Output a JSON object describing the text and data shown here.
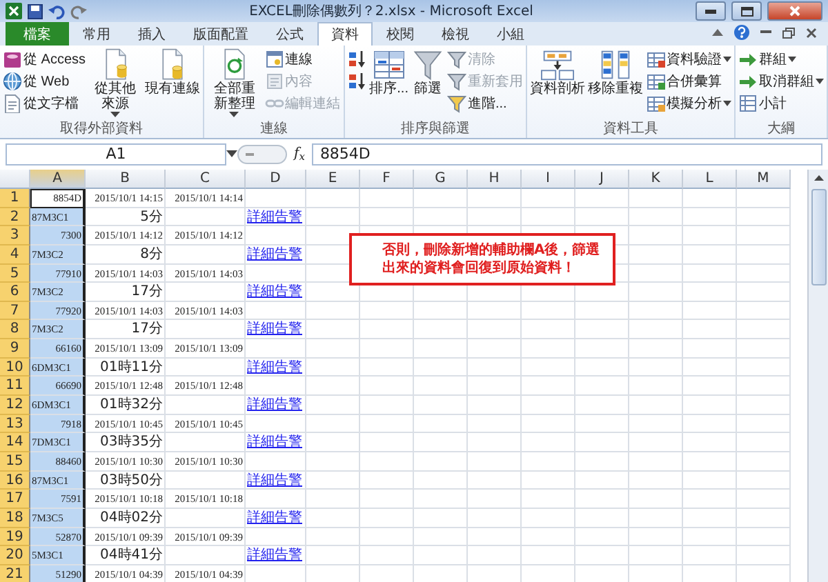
{
  "window": {
    "title": "EXCEL刪除偶數列？2.xlsx - Microsoft Excel"
  },
  "ribbon_tabs": [
    {
      "label": "檔案",
      "kind": "file",
      "selected": false
    },
    {
      "label": "常用",
      "kind": "tab",
      "selected": false
    },
    {
      "label": "插入",
      "kind": "tab",
      "selected": false
    },
    {
      "label": "版面配置",
      "kind": "tab",
      "selected": false
    },
    {
      "label": "公式",
      "kind": "tab",
      "selected": false
    },
    {
      "label": "資料",
      "kind": "tab",
      "selected": true
    },
    {
      "label": "校閱",
      "kind": "tab",
      "selected": false
    },
    {
      "label": "檢視",
      "kind": "tab",
      "selected": false
    },
    {
      "label": "小組",
      "kind": "tab",
      "selected": false
    }
  ],
  "ribbon_groups": [
    {
      "label": "取得外部資料",
      "columns": [
        [
          {
            "kind": "small",
            "label": "從 Access",
            "disabled": false
          },
          {
            "kind": "small",
            "label": "從 Web",
            "disabled": false
          },
          {
            "kind": "small",
            "label": "從文字檔",
            "disabled": false
          }
        ],
        [
          {
            "kind": "large",
            "label": "從其他來源",
            "dropdown": true,
            "disabled": false
          }
        ],
        [
          {
            "kind": "large",
            "label": "現有連線",
            "dropdown": false,
            "disabled": false
          }
        ]
      ]
    },
    {
      "label": "連線",
      "columns": [
        [
          {
            "kind": "large",
            "label": "全部重新整理",
            "dropdown": true,
            "disabled": false
          }
        ],
        [
          {
            "kind": "small",
            "label": "連線",
            "disabled": false
          },
          {
            "kind": "small",
            "label": "內容",
            "disabled": true
          },
          {
            "kind": "small",
            "label": "編輯連結",
            "disabled": true
          }
        ]
      ]
    },
    {
      "label": "排序與篩選",
      "columns": [
        [
          {
            "kind": "icon"
          },
          {
            "kind": "icon"
          }
        ],
        [
          {
            "kind": "large",
            "label": "排序...",
            "dropdown": false,
            "disabled": false
          }
        ],
        [
          {
            "kind": "large",
            "label": "篩選",
            "dropdown": false,
            "disabled": false
          }
        ],
        [
          {
            "kind": "small",
            "label": "清除",
            "disabled": true
          },
          {
            "kind": "small",
            "label": "重新套用",
            "disabled": true
          },
          {
            "kind": "small",
            "label": "進階...",
            "disabled": false
          }
        ]
      ]
    },
    {
      "label": "資料工具",
      "columns": [
        [
          {
            "kind": "large",
            "label": "資料剖析",
            "dropdown": false,
            "disabled": false
          }
        ],
        [
          {
            "kind": "large",
            "label": "移除重複",
            "dropdown": false,
            "disabled": false
          }
        ],
        [
          {
            "kind": "small",
            "label": "資料驗證",
            "dropdown": true,
            "disabled": false
          },
          {
            "kind": "small",
            "label": "合併彙算",
            "disabled": false
          },
          {
            "kind": "small",
            "label": "模擬分析",
            "dropdown": true,
            "disabled": false
          }
        ]
      ]
    },
    {
      "label": "大綱",
      "columns": [
        [
          {
            "kind": "small",
            "label": "群組",
            "dropdown": true,
            "disabled": false
          },
          {
            "kind": "small",
            "label": "取消群組",
            "dropdown": true,
            "disabled": false
          },
          {
            "kind": "small",
            "label": "小計",
            "disabled": false
          }
        ]
      ]
    }
  ],
  "formula_bar": {
    "name_box": "A1",
    "function_label": "f$_{x}$",
    "value": "8854D"
  },
  "columns": [
    {
      "label": "A",
      "selected": true
    },
    {
      "label": "B",
      "selected": false
    },
    {
      "label": "C",
      "selected": false
    },
    {
      "label": "D",
      "selected": false
    },
    {
      "label": "E",
      "selected": false
    },
    {
      "label": "F",
      "selected": false
    },
    {
      "label": "G",
      "selected": false
    },
    {
      "label": "H",
      "selected": false
    },
    {
      "label": "I",
      "selected": false
    },
    {
      "label": "J",
      "selected": false
    },
    {
      "label": "K",
      "selected": false
    },
    {
      "label": "L",
      "selected": false
    },
    {
      "label": "M",
      "selected": false
    }
  ],
  "rows": [
    {
      "number": "1",
      "kind": "time",
      "active": true,
      "a": "8854D",
      "b": "2015/10/1 14:15",
      "c": "2015/10/1 14:14"
    },
    {
      "number": "2",
      "kind": "alert",
      "active": false,
      "a": "87M3C1",
      "b": "5分",
      "d": "詳細告警"
    },
    {
      "number": "3",
      "kind": "time",
      "active": false,
      "a": "7300",
      "b": "2015/10/1 14:12",
      "c": "2015/10/1 14:12"
    },
    {
      "number": "4",
      "kind": "alert",
      "active": false,
      "a": "7M3C2",
      "b": "8分",
      "d": "詳細告警"
    },
    {
      "number": "5",
      "kind": "time",
      "active": false,
      "a": "77910",
      "b": "2015/10/1 14:03",
      "c": "2015/10/1 14:03"
    },
    {
      "number": "6",
      "kind": "alert",
      "active": false,
      "a": "7M3C2",
      "b": "17分",
      "d": "詳細告警"
    },
    {
      "number": "7",
      "kind": "time",
      "active": false,
      "a": "77920",
      "b": "2015/10/1 14:03",
      "c": "2015/10/1 14:03"
    },
    {
      "number": "8",
      "kind": "alert",
      "active": false,
      "a": "7M3C2",
      "b": "17分",
      "d": "詳細告警"
    },
    {
      "number": "9",
      "kind": "time",
      "active": false,
      "a": "66160",
      "b": "2015/10/1 13:09",
      "c": "2015/10/1 13:09"
    },
    {
      "number": "10",
      "kind": "alert",
      "active": false,
      "a": "6DM3C1",
      "b": "01時11分",
      "d": "詳細告警"
    },
    {
      "number": "11",
      "kind": "time",
      "active": false,
      "a": "66690",
      "b": "2015/10/1 12:48",
      "c": "2015/10/1 12:48"
    },
    {
      "number": "12",
      "kind": "alert",
      "active": false,
      "a": "6DM3C1",
      "b": "01時32分",
      "d": "詳細告警"
    },
    {
      "number": "13",
      "kind": "time",
      "active": false,
      "a": "7918",
      "b": "2015/10/1 10:45",
      "c": "2015/10/1 10:45"
    },
    {
      "number": "14",
      "kind": "alert",
      "active": false,
      "a": "7DM3C1",
      "b": "03時35分",
      "d": "詳細告警"
    },
    {
      "number": "15",
      "kind": "time",
      "active": false,
      "a": "88460",
      "b": "2015/10/1 10:30",
      "c": "2015/10/1 10:30"
    },
    {
      "number": "16",
      "kind": "alert",
      "active": false,
      "a": "87M3C1",
      "b": "03時50分",
      "d": "詳細告警"
    },
    {
      "number": "17",
      "kind": "time",
      "active": false,
      "a": "7591",
      "b": "2015/10/1 10:18",
      "c": "2015/10/1 10:18"
    },
    {
      "number": "18",
      "kind": "alert",
      "active": false,
      "a": "7M3C5",
      "b": "04時02分",
      "d": "詳細告警"
    },
    {
      "number": "19",
      "kind": "time",
      "active": false,
      "a": "52870",
      "b": "2015/10/1 09:39",
      "c": "2015/10/1 09:39"
    },
    {
      "number": "20",
      "kind": "alert",
      "active": false,
      "a": "5M3C1",
      "b": "04時41分",
      "d": "詳細告警"
    },
    {
      "number": "21",
      "kind": "time",
      "active": false,
      "a": "51290",
      "b": "2015/10/1 04:39",
      "c": "2015/10/1 04:39"
    }
  ],
  "callout": {
    "text": "否則，刪除新增的輔助欄A後，篩選出來的資料會回復到原始資料！"
  }
}
